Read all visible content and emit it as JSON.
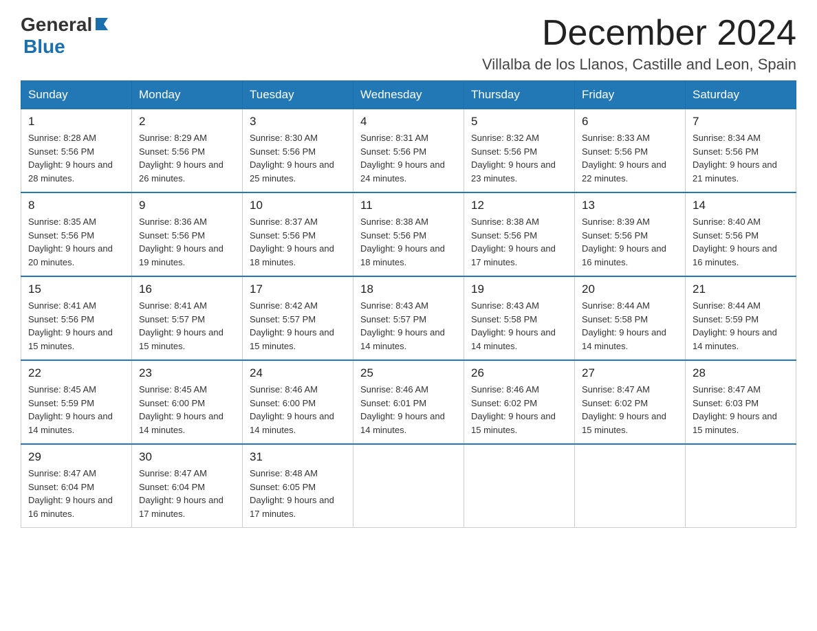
{
  "logo": {
    "general": "General",
    "blue": "Blue"
  },
  "title": {
    "month_year": "December 2024",
    "location": "Villalba de los Llanos, Castille and Leon, Spain"
  },
  "headers": [
    "Sunday",
    "Monday",
    "Tuesday",
    "Wednesday",
    "Thursday",
    "Friday",
    "Saturday"
  ],
  "weeks": [
    [
      {
        "day": "1",
        "sunrise": "Sunrise: 8:28 AM",
        "sunset": "Sunset: 5:56 PM",
        "daylight": "Daylight: 9 hours and 28 minutes."
      },
      {
        "day": "2",
        "sunrise": "Sunrise: 8:29 AM",
        "sunset": "Sunset: 5:56 PM",
        "daylight": "Daylight: 9 hours and 26 minutes."
      },
      {
        "day": "3",
        "sunrise": "Sunrise: 8:30 AM",
        "sunset": "Sunset: 5:56 PM",
        "daylight": "Daylight: 9 hours and 25 minutes."
      },
      {
        "day": "4",
        "sunrise": "Sunrise: 8:31 AM",
        "sunset": "Sunset: 5:56 PM",
        "daylight": "Daylight: 9 hours and 24 minutes."
      },
      {
        "day": "5",
        "sunrise": "Sunrise: 8:32 AM",
        "sunset": "Sunset: 5:56 PM",
        "daylight": "Daylight: 9 hours and 23 minutes."
      },
      {
        "day": "6",
        "sunrise": "Sunrise: 8:33 AM",
        "sunset": "Sunset: 5:56 PM",
        "daylight": "Daylight: 9 hours and 22 minutes."
      },
      {
        "day": "7",
        "sunrise": "Sunrise: 8:34 AM",
        "sunset": "Sunset: 5:56 PM",
        "daylight": "Daylight: 9 hours and 21 minutes."
      }
    ],
    [
      {
        "day": "8",
        "sunrise": "Sunrise: 8:35 AM",
        "sunset": "Sunset: 5:56 PM",
        "daylight": "Daylight: 9 hours and 20 minutes."
      },
      {
        "day": "9",
        "sunrise": "Sunrise: 8:36 AM",
        "sunset": "Sunset: 5:56 PM",
        "daylight": "Daylight: 9 hours and 19 minutes."
      },
      {
        "day": "10",
        "sunrise": "Sunrise: 8:37 AM",
        "sunset": "Sunset: 5:56 PM",
        "daylight": "Daylight: 9 hours and 18 minutes."
      },
      {
        "day": "11",
        "sunrise": "Sunrise: 8:38 AM",
        "sunset": "Sunset: 5:56 PM",
        "daylight": "Daylight: 9 hours and 18 minutes."
      },
      {
        "day": "12",
        "sunrise": "Sunrise: 8:38 AM",
        "sunset": "Sunset: 5:56 PM",
        "daylight": "Daylight: 9 hours and 17 minutes."
      },
      {
        "day": "13",
        "sunrise": "Sunrise: 8:39 AM",
        "sunset": "Sunset: 5:56 PM",
        "daylight": "Daylight: 9 hours and 16 minutes."
      },
      {
        "day": "14",
        "sunrise": "Sunrise: 8:40 AM",
        "sunset": "Sunset: 5:56 PM",
        "daylight": "Daylight: 9 hours and 16 minutes."
      }
    ],
    [
      {
        "day": "15",
        "sunrise": "Sunrise: 8:41 AM",
        "sunset": "Sunset: 5:56 PM",
        "daylight": "Daylight: 9 hours and 15 minutes."
      },
      {
        "day": "16",
        "sunrise": "Sunrise: 8:41 AM",
        "sunset": "Sunset: 5:57 PM",
        "daylight": "Daylight: 9 hours and 15 minutes."
      },
      {
        "day": "17",
        "sunrise": "Sunrise: 8:42 AM",
        "sunset": "Sunset: 5:57 PM",
        "daylight": "Daylight: 9 hours and 15 minutes."
      },
      {
        "day": "18",
        "sunrise": "Sunrise: 8:43 AM",
        "sunset": "Sunset: 5:57 PM",
        "daylight": "Daylight: 9 hours and 14 minutes."
      },
      {
        "day": "19",
        "sunrise": "Sunrise: 8:43 AM",
        "sunset": "Sunset: 5:58 PM",
        "daylight": "Daylight: 9 hours and 14 minutes."
      },
      {
        "day": "20",
        "sunrise": "Sunrise: 8:44 AM",
        "sunset": "Sunset: 5:58 PM",
        "daylight": "Daylight: 9 hours and 14 minutes."
      },
      {
        "day": "21",
        "sunrise": "Sunrise: 8:44 AM",
        "sunset": "Sunset: 5:59 PM",
        "daylight": "Daylight: 9 hours and 14 minutes."
      }
    ],
    [
      {
        "day": "22",
        "sunrise": "Sunrise: 8:45 AM",
        "sunset": "Sunset: 5:59 PM",
        "daylight": "Daylight: 9 hours and 14 minutes."
      },
      {
        "day": "23",
        "sunrise": "Sunrise: 8:45 AM",
        "sunset": "Sunset: 6:00 PM",
        "daylight": "Daylight: 9 hours and 14 minutes."
      },
      {
        "day": "24",
        "sunrise": "Sunrise: 8:46 AM",
        "sunset": "Sunset: 6:00 PM",
        "daylight": "Daylight: 9 hours and 14 minutes."
      },
      {
        "day": "25",
        "sunrise": "Sunrise: 8:46 AM",
        "sunset": "Sunset: 6:01 PM",
        "daylight": "Daylight: 9 hours and 14 minutes."
      },
      {
        "day": "26",
        "sunrise": "Sunrise: 8:46 AM",
        "sunset": "Sunset: 6:02 PM",
        "daylight": "Daylight: 9 hours and 15 minutes."
      },
      {
        "day": "27",
        "sunrise": "Sunrise: 8:47 AM",
        "sunset": "Sunset: 6:02 PM",
        "daylight": "Daylight: 9 hours and 15 minutes."
      },
      {
        "day": "28",
        "sunrise": "Sunrise: 8:47 AM",
        "sunset": "Sunset: 6:03 PM",
        "daylight": "Daylight: 9 hours and 15 minutes."
      }
    ],
    [
      {
        "day": "29",
        "sunrise": "Sunrise: 8:47 AM",
        "sunset": "Sunset: 6:04 PM",
        "daylight": "Daylight: 9 hours and 16 minutes."
      },
      {
        "day": "30",
        "sunrise": "Sunrise: 8:47 AM",
        "sunset": "Sunset: 6:04 PM",
        "daylight": "Daylight: 9 hours and 17 minutes."
      },
      {
        "day": "31",
        "sunrise": "Sunrise: 8:48 AM",
        "sunset": "Sunset: 6:05 PM",
        "daylight": "Daylight: 9 hours and 17 minutes."
      },
      null,
      null,
      null,
      null
    ]
  ]
}
